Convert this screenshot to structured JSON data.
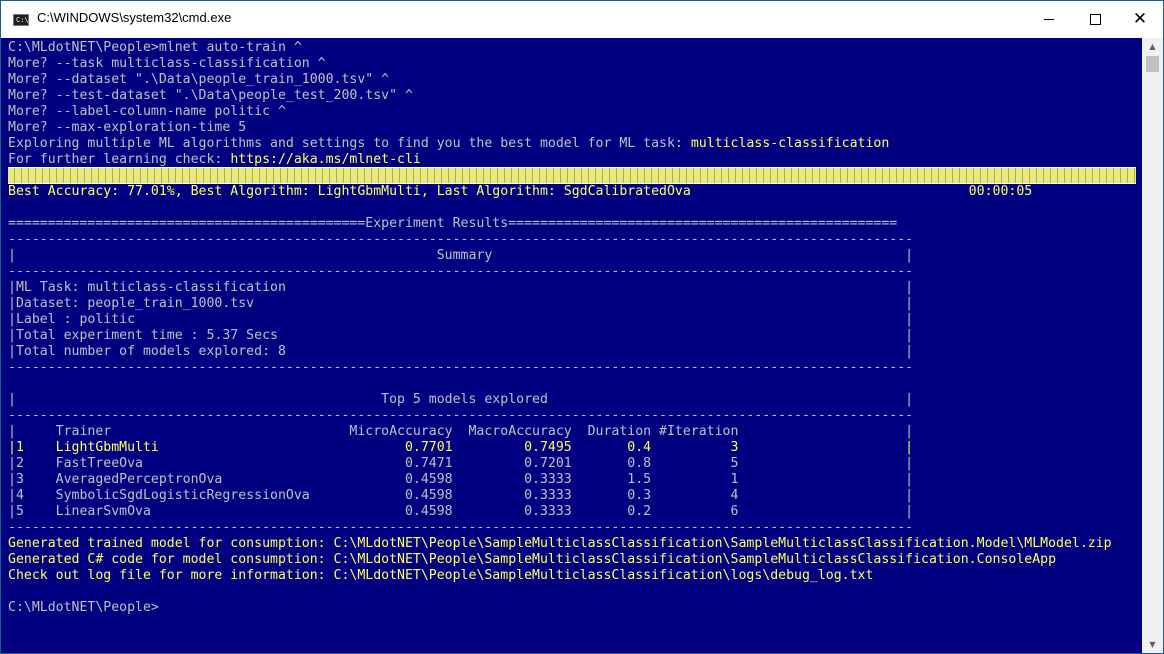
{
  "window": {
    "title": "C:\\WINDOWS\\system32\\cmd.exe",
    "icon_text": "C:\\",
    "colors": {
      "console_bg": "#000080",
      "text": "#c0c0c0",
      "highlight": "#ffff60"
    }
  },
  "console": {
    "lines": [
      {
        "text": "C:\\MLdotNET\\People>mlnet auto-train ^",
        "color": "w"
      },
      {
        "text": "More? --task multiclass-classification ^",
        "color": "w"
      },
      {
        "text": "More? --dataset \".\\Data\\people_train_1000.tsv\" ^",
        "color": "w"
      },
      {
        "text": "More? --test-dataset \".\\Data\\people_test_200.tsv\" ^",
        "color": "w"
      },
      {
        "text": "More? --label-column-name politic ^",
        "color": "w"
      },
      {
        "text": "More? --max-exploration-time 5",
        "color": "w"
      },
      {
        "segments": [
          {
            "text": "Exploring multiple ML algorithms and settings to find you the best model for ML task: ",
            "color": "w"
          },
          {
            "text": "multiclass-classification",
            "color": "y"
          }
        ]
      },
      {
        "segments": [
          {
            "text": "For further learning check: ",
            "color": "w"
          },
          {
            "text": "https://aka.ms/mlnet-cli",
            "color": "y"
          }
        ]
      },
      {
        "text": "",
        "color": "w",
        "progress": true
      },
      {
        "text": "Best Accuracy: 77.01%, Best Algorithm: LightGbmMulti, Last Algorithm: SgdCalibratedOva                                   00:00:05",
        "color": "y"
      },
      {
        "text": "",
        "color": "w"
      },
      {
        "text": "=============================================Experiment Results=================================================",
        "color": "w"
      },
      {
        "text": "------------------------------------------------------------------------------------------------------------------",
        "color": "w"
      },
      {
        "text": "|                                                     Summary                                                    |",
        "color": "w"
      },
      {
        "text": "------------------------------------------------------------------------------------------------------------------",
        "color": "w"
      },
      {
        "text": "|ML Task: multiclass-classification                                                                              |",
        "color": "w"
      },
      {
        "text": "|Dataset: people_train_1000.tsv                                                                                  |",
        "color": "w"
      },
      {
        "text": "|Label : politic                                                                                                 |",
        "color": "w"
      },
      {
        "text": "|Total experiment time : 5.37 Secs                                                                               |",
        "color": "w"
      },
      {
        "text": "|Total number of models explored: 8                                                                              |",
        "color": "w"
      },
      {
        "text": "------------------------------------------------------------------------------------------------------------------",
        "color": "w"
      },
      {
        "text": "",
        "color": "w"
      },
      {
        "text": "|                                              Top 5 models explored                                             |",
        "color": "w"
      },
      {
        "text": "------------------------------------------------------------------------------------------------------------------",
        "color": "w"
      },
      {
        "text": "|     Trainer                              MicroAccuracy  MacroAccuracy  Duration #Iteration                     |",
        "color": "w"
      },
      {
        "text": "|1    LightGbmMulti                               0.7701         0.7495       0.4          3                     |",
        "color": "y"
      },
      {
        "text": "|2    FastTreeOva                                 0.7471         0.7201       0.8          5                     |",
        "color": "w"
      },
      {
        "text": "|3    AveragedPerceptronOva                       0.4598         0.3333       1.5          1                     |",
        "color": "w"
      },
      {
        "text": "|4    SymbolicSgdLogisticRegressionOva            0.4598         0.3333       0.3          4                     |",
        "color": "w"
      },
      {
        "text": "|5    LinearSvmOva                                0.4598         0.3333       0.2          6                     |",
        "color": "w"
      },
      {
        "text": "------------------------------------------------------------------------------------------------------------------",
        "color": "w"
      },
      {
        "text": "Generated trained model for consumption: C:\\MLdotNET\\People\\SampleMulticlassClassification\\SampleMulticlassClassification.Model\\MLModel.zip",
        "color": "y"
      },
      {
        "text": "Generated C# code for model consumption: C:\\MLdotNET\\People\\SampleMulticlassClassification\\SampleMulticlassClassification.ConsoleApp",
        "color": "y"
      },
      {
        "text": "Check out log file for more information: C:\\MLdotNET\\People\\SampleMulticlassClassification\\logs\\debug_log.txt",
        "color": "y"
      },
      {
        "text": "",
        "color": "w"
      },
      {
        "text": "C:\\MLdotNET\\People>",
        "color": "w"
      }
    ]
  }
}
